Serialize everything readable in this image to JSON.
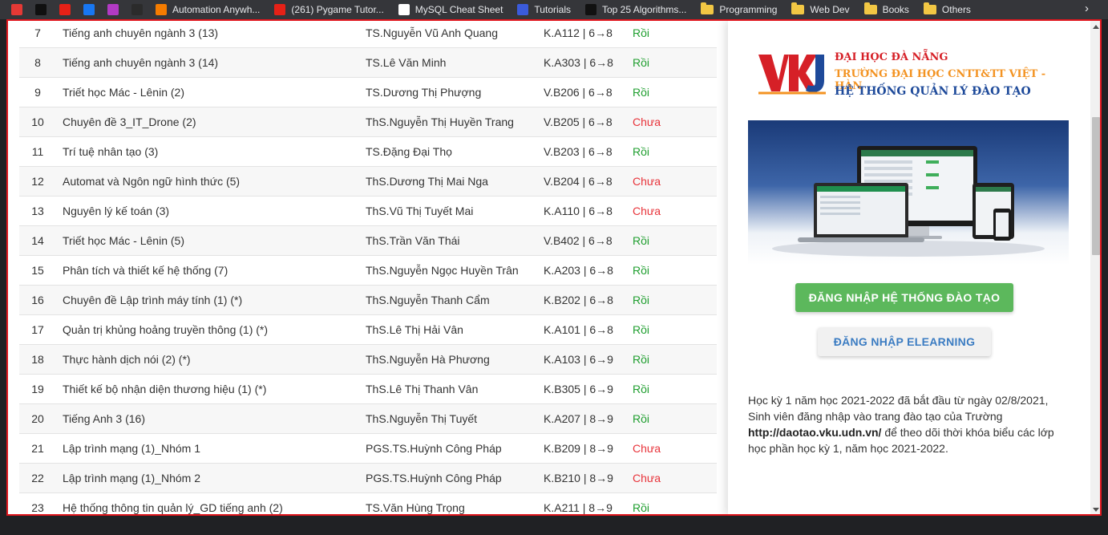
{
  "bookmarks": [
    {
      "label": "",
      "color": "#e53935"
    },
    {
      "label": "",
      "color": "#101010"
    },
    {
      "label": "",
      "color": "#e62117"
    },
    {
      "label": "",
      "color": "#1877f2"
    },
    {
      "label": "",
      "color": "#b23ac4"
    },
    {
      "label": "",
      "color": "#2b2b2b"
    },
    {
      "label": "Automation Anywh...",
      "color": "#f57c00"
    },
    {
      "label": "(261) Pygame Tutor...",
      "color": "#e62117"
    },
    {
      "label": "MySQL Cheat Sheet",
      "color": "#ffffff"
    },
    {
      "label": "Tutorials",
      "color": "#3b5bdb"
    },
    {
      "label": "Top 25 Algorithms...",
      "color": "#111111"
    },
    {
      "label": "Programming",
      "color": "#f2c744"
    },
    {
      "label": "Web Dev",
      "color": "#f2c744"
    },
    {
      "label": "Books",
      "color": "#f2c744"
    },
    {
      "label": "Others",
      "color": "#f2c744"
    }
  ],
  "bookmarks_more": "›",
  "schedule_rows": [
    {
      "no": "7",
      "course": "Tiếng anh chuyên ngành 3 (13)",
      "teacher": "TS.Nguyễn Vũ Anh Quang",
      "room": "K.A112 | 6→8",
      "status": "Rồi"
    },
    {
      "no": "8",
      "course": "Tiếng anh chuyên ngành 3 (14)",
      "teacher": "TS.Lê Văn Minh",
      "room": "K.A303 | 6→8",
      "status": "Rồi"
    },
    {
      "no": "9",
      "course": "Triết học Mác - Lênin (2)",
      "teacher": "TS.Dương Thị Phượng",
      "room": "V.B206 | 6→8",
      "status": "Rồi"
    },
    {
      "no": "10",
      "course": "Chuyên đề 3_IT_Drone (2)",
      "teacher": "ThS.Nguyễn Thị Huyền Trang",
      "room": "V.B205 | 6→8",
      "status": "Chưa"
    },
    {
      "no": "11",
      "course": "Trí tuệ nhân tạo (3)",
      "teacher": "TS.Đặng Đại Thọ",
      "room": "V.B203 | 6→8",
      "status": "Rồi"
    },
    {
      "no": "12",
      "course": "Automat và Ngôn ngữ hình thức (5)",
      "teacher": "ThS.Dương Thị Mai Nga",
      "room": "V.B204 | 6→8",
      "status": "Chưa"
    },
    {
      "no": "13",
      "course": "Nguyên lý kế toán (3)",
      "teacher": "ThS.Vũ Thị Tuyết Mai",
      "room": "K.A110 | 6→8",
      "status": "Chưa"
    },
    {
      "no": "14",
      "course": "Triết học Mác - Lênin (5)",
      "teacher": "ThS.Trần Văn Thái",
      "room": "V.B402 | 6→8",
      "status": "Rồi"
    },
    {
      "no": "15",
      "course": "Phân tích và thiết kế hệ thống (7)",
      "teacher": "ThS.Nguyễn Ngọc Huyền Trân",
      "room": "K.A203 | 6→8",
      "status": "Rồi"
    },
    {
      "no": "16",
      "course": "Chuyên đề Lập trình máy tính (1) (*)",
      "teacher": "ThS.Nguyễn Thanh Cẩm",
      "room": "K.B202 | 6→8",
      "status": "Rồi"
    },
    {
      "no": "17",
      "course": "Quản trị khủng hoảng truyền thông (1) (*)",
      "teacher": "ThS.Lê Thị Hải Vân",
      "room": "K.A101 | 6→8",
      "status": "Rồi"
    },
    {
      "no": "18",
      "course": "Thực hành dịch nói (2) (*)",
      "teacher": "ThS.Nguyễn Hà Phương",
      "room": "K.A103 | 6→9",
      "status": "Rồi"
    },
    {
      "no": "19",
      "course": "Thiết kế bộ nhận diện thương hiệu (1) (*)",
      "teacher": "ThS.Lê Thị Thanh Vân",
      "room": "K.B305 | 6→9",
      "status": "Rồi"
    },
    {
      "no": "20",
      "course": "Tiếng Anh 3 (16)",
      "teacher": "ThS.Nguyễn Thị Tuyết",
      "room": "K.A207 | 8→9",
      "status": "Rồi"
    },
    {
      "no": "21",
      "course": "Lập trình mạng (1)_Nhóm 1",
      "teacher": "PGS.TS.Huỳnh Công Pháp",
      "room": "K.B209 | 8→9",
      "status": "Chưa"
    },
    {
      "no": "22",
      "course": "Lập trình mạng (1)_Nhóm 2",
      "teacher": "PGS.TS.Huỳnh Công Pháp",
      "room": "K.B210 | 8→9",
      "status": "Chưa"
    },
    {
      "no": "23",
      "course": "Hệ thống thông tin quản lý_GD tiếng anh (2)",
      "teacher": "TS.Văn Hùng Trọng",
      "room": "K.A211 | 8→9",
      "status": "Rồi"
    }
  ],
  "status_colors": {
    "Rồi": "#1e9e2e",
    "Chưa": "#e8333a"
  },
  "panel": {
    "logo_mark": "VKU",
    "logo_line1": "ĐẠI HỌC ĐÀ NẴNG",
    "logo_line2": "TRƯỜNG ĐẠI HỌC CNTT&TT VIỆT - HÀN",
    "logo_line3": "HỆ THỐNG QUẢN LÝ ĐÀO TẠO",
    "login_training_label": "ĐĂNG NHẬP HỆ THỐNG ĐÀO TẠO",
    "login_elearning_label": "ĐĂNG NHẬP ELEARNING",
    "notice_before": "Học kỳ 1 năm học 2021-2022 đã bắt đầu từ ngày 02/8/2021, Sinh viên đăng nhập vào trang đào tạo của Trường ",
    "notice_link": "http://daotao.vku.udn.vn/",
    "notice_after": " để theo dõi thời khóa biểu các lớp học phần học kỳ 1, năm học 2021-2022."
  }
}
